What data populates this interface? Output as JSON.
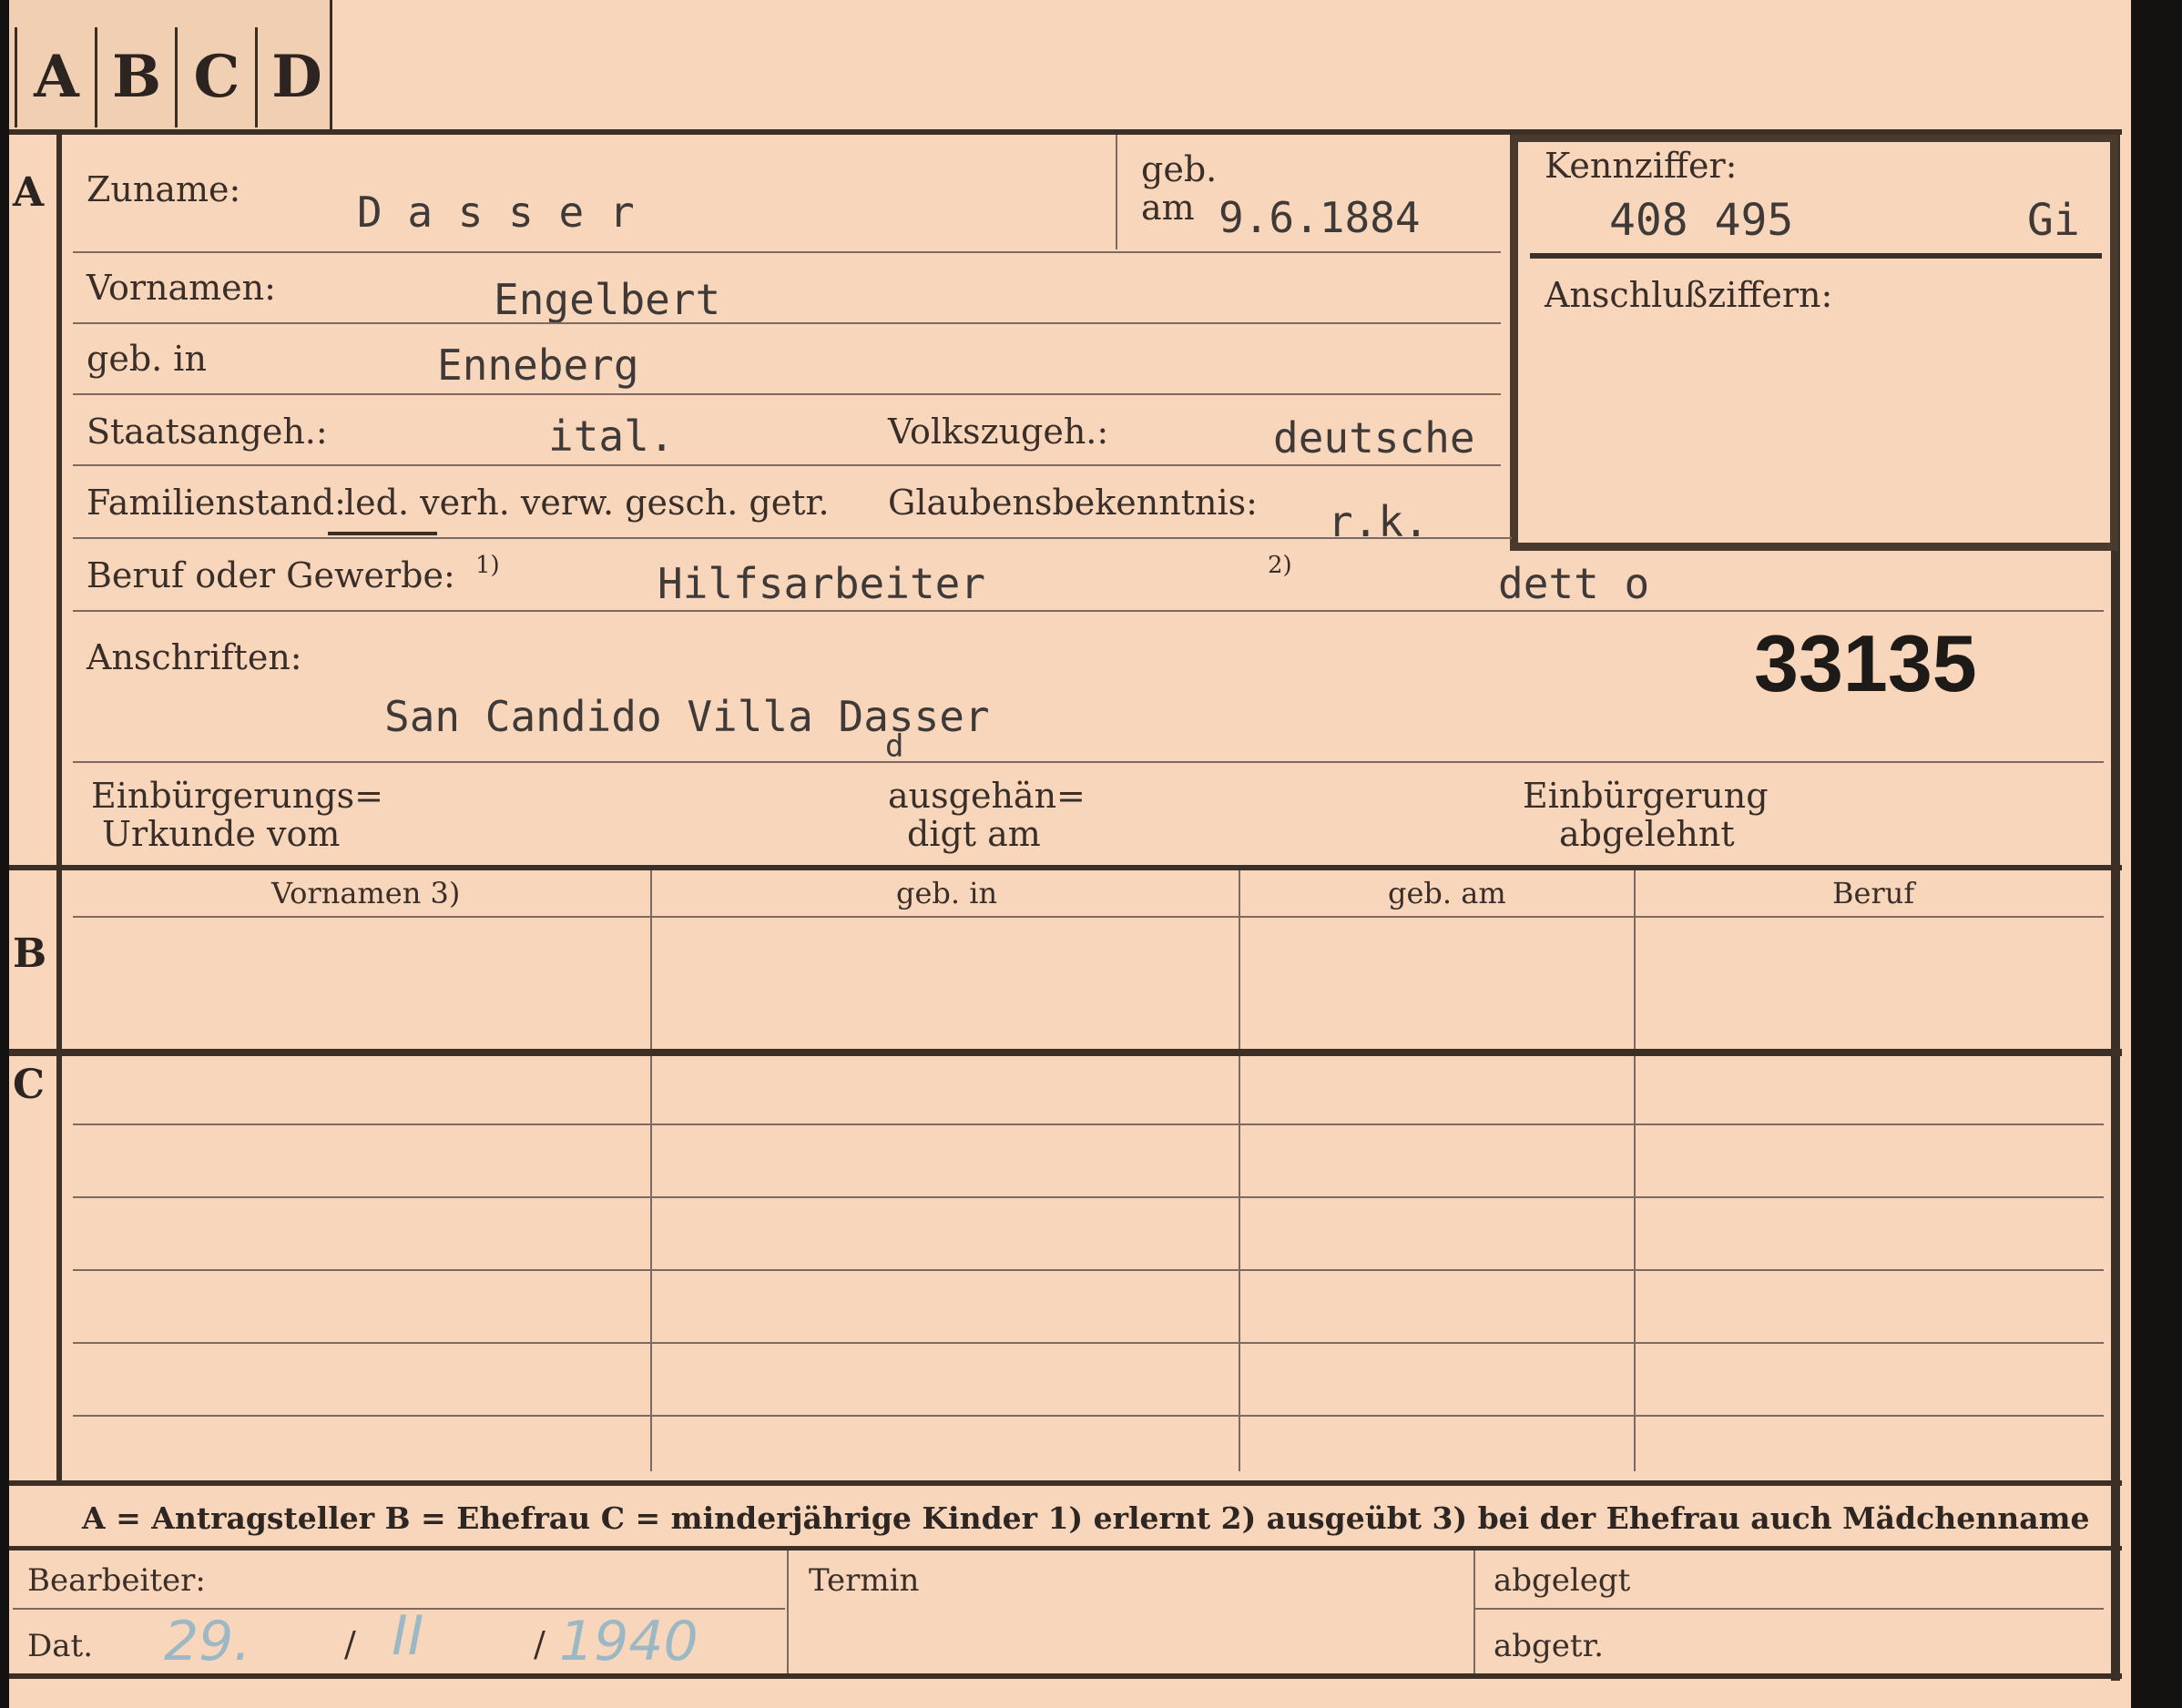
{
  "tabs": [
    "A",
    "B",
    "C",
    "D"
  ],
  "section_a": {
    "marker": "A",
    "zuname_label": "Zuname:",
    "zuname_value": "D a s s e r",
    "geb_label": "geb.",
    "am_label": "am",
    "geb_am_value": "9.6.1884",
    "kennziffer_label": "Kennziffer:",
    "kennziffer_value": "408 495",
    "kennziffer_suffix": "Gi",
    "anschluss_label": "Anschlußziffern:",
    "vornamen_label": "Vornamen:",
    "vornamen_value": "Engelbert",
    "geb_in_label": "geb. in",
    "geb_in_value": "Enneberg",
    "staats_label": "Staatsangeh.:",
    "staats_value": "ital.",
    "volks_label": "Volkszugeh.:",
    "volks_value": "deutsche",
    "familien_label": "Familienstand:",
    "familien_options": "led. verh. verw. gesch. getr.",
    "glaubens_label": "Glaubensbekenntnis:",
    "glaubens_value": "r.k.",
    "beruf_label": "Beruf oder Gewerbe:",
    "beruf_note1": "1)",
    "beruf_value1": "Hilfsarbeiter",
    "beruf_note2": "2)",
    "beruf_value2": "dett o",
    "anschriften_label": "Anschriften:",
    "anschrift_value": "San Candido Villa Dasser",
    "anschrift_correction": "d",
    "stamp_number": "33135",
    "einb_label_1": "Einbürgerungs=",
    "einb_label_2": "Urkunde vom",
    "ausgeh_label_1": "ausgehän=",
    "ausgeh_label_2": "digt am",
    "abgelehnt_label_1": "Einbürgerung",
    "abgelehnt_label_2": "abgelehnt"
  },
  "section_b": {
    "marker": "B",
    "headers": [
      "Vornamen 3)",
      "geb. in",
      "geb. am",
      "Beruf"
    ]
  },
  "section_c": {
    "marker": "C"
  },
  "legend": "A = Antragsteller    B = Ehefrau    C = minderjährige Kinder    1) erlernt    2) ausgeübt    3) bei der Ehefrau auch Mädchenname",
  "footer": {
    "bearbeiter_label": "Bearbeiter:",
    "dat_label": "Dat.",
    "dat_day": "29.",
    "dat_sep1": "/",
    "dat_month": "II",
    "dat_sep2": "/",
    "dat_year": "1940",
    "termin_label": "Termin",
    "abgelegt_label": "abgelegt",
    "abgetr_label": "abgetr."
  }
}
